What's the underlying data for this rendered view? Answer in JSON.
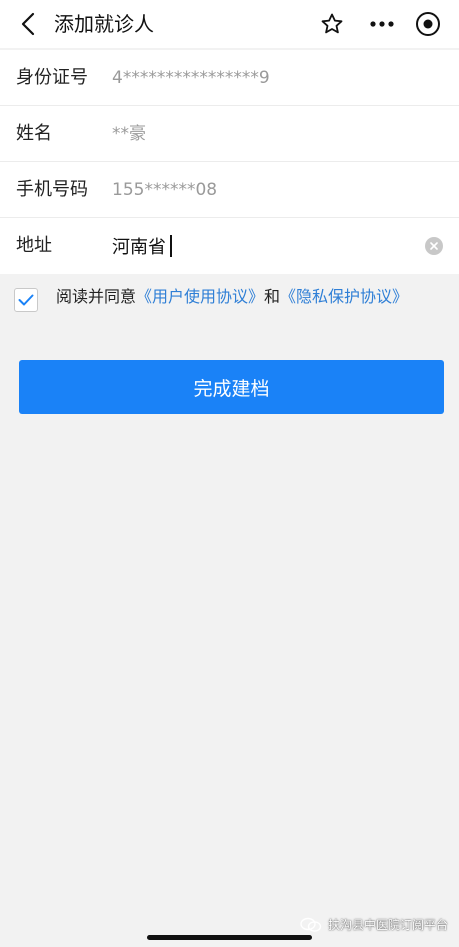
{
  "header": {
    "title": "添加就诊人"
  },
  "form": {
    "rows": [
      {
        "label": "身份证号",
        "value": "4****************9"
      },
      {
        "label": "姓名",
        "value": "**豪"
      },
      {
        "label": "手机号码",
        "value": "155******08"
      },
      {
        "label": "地址",
        "value": "河南省"
      }
    ]
  },
  "agreement": {
    "checked": true,
    "prefix": "阅读并同意",
    "link1": "《用户使用协议》",
    "conjunction": "和",
    "link2": "《隐私保护协议》"
  },
  "submit": {
    "label": "完成建档"
  },
  "watermark": {
    "text": "扶沟县中医院订阅平台"
  },
  "colors": {
    "primary": "#1a82f7",
    "link": "#2f7fd6",
    "placeholder": "#9a9a9a",
    "background": "#f2f2f2"
  },
  "icons": {
    "back": "chevron-left-icon",
    "favorite": "star-icon",
    "more": "more-dots-icon",
    "capsule": "target-circle-icon",
    "clear": "clear-x-icon",
    "check": "checkmark-icon",
    "watermark": "wechat-logo-icon"
  }
}
